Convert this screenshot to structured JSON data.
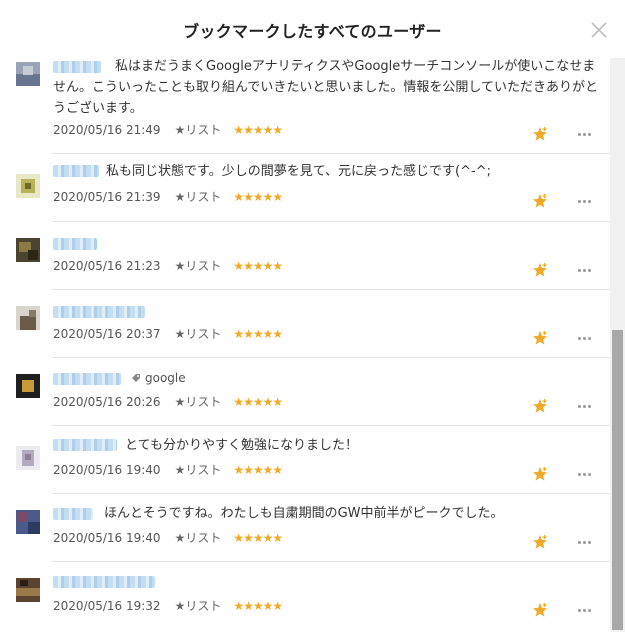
{
  "modal": {
    "title": "ブックマークしたすべてのユーザー"
  },
  "entries": [
    {
      "comment": "私はまだうまくGoogleアナリティクスやGoogleサーチコンソールが使いこなせません。こういったことも取り組んでいきたいと思いました。情報を公開していただきありがとうございます。",
      "date": "2020/05/16 21:49",
      "list_label": "★リスト",
      "stars": "★★★★★"
    },
    {
      "comment": "私も同じ状態です。少しの間夢を見て、元に戻った感じです(^-^;",
      "date": "2020/05/16 21:39",
      "list_label": "★リスト",
      "stars": "★★★★★"
    },
    {
      "comment": "",
      "date": "2020/05/16 21:23",
      "list_label": "★リスト",
      "stars": "★★★★★"
    },
    {
      "comment": "",
      "date": "2020/05/16 20:37",
      "list_label": "★リスト",
      "stars": "★★★★★"
    },
    {
      "comment": "",
      "tag": "google",
      "date": "2020/05/16 20:26",
      "list_label": "★リスト",
      "stars": "★★★★★"
    },
    {
      "comment": "とても分かりやすく勉強になりました！",
      "date": "2020/05/16 19:40",
      "list_label": "★リスト",
      "stars": "★★★★★"
    },
    {
      "comment": "ほんとそうですね。わたしも自粛期間のGW中前半がピークでした。",
      "date": "2020/05/16 19:40",
      "list_label": "★リスト",
      "stars": "★★★★★"
    },
    {
      "comment": "",
      "date": "2020/05/16 19:32",
      "list_label": "★リスト",
      "stars": "★★★★★"
    }
  ],
  "colors": {
    "star_accent": "#f0a926",
    "username_blur": "#b9d7ee",
    "divider": "#e3e3e3"
  },
  "icons": {
    "close": "close-icon",
    "star_button": "star-icon",
    "more": "more-dots-icon",
    "tag": "tag-icon"
  }
}
